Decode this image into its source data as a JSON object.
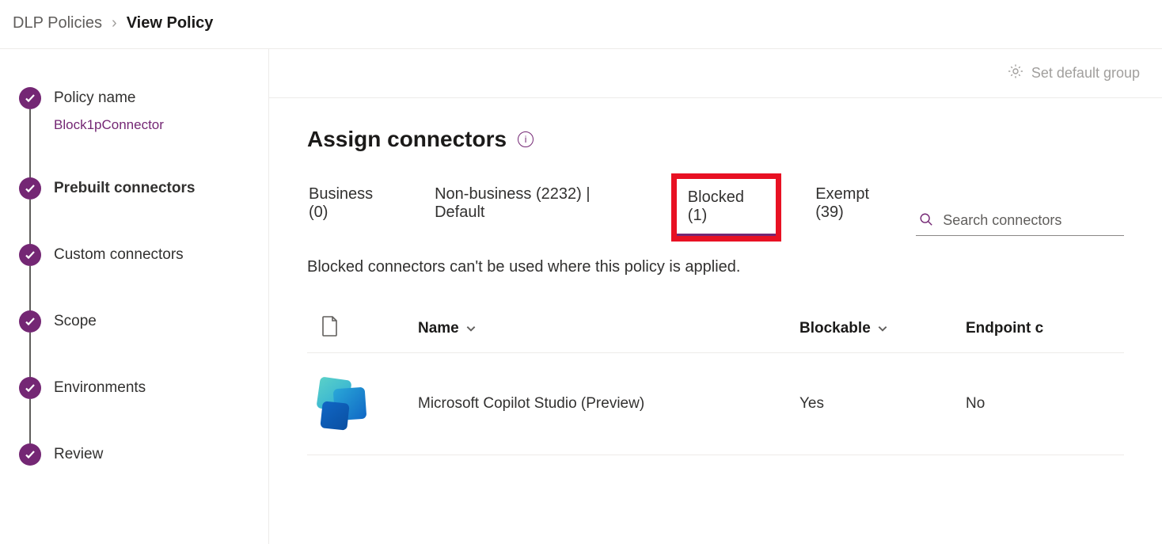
{
  "breadcrumb": {
    "root": "DLP Policies",
    "separator": "›",
    "current": "View Policy"
  },
  "steps": [
    {
      "label": "Policy name",
      "sublabel": "Block1pConnector",
      "active": false
    },
    {
      "label": "Prebuilt connectors",
      "active": true
    },
    {
      "label": "Custom connectors",
      "active": false
    },
    {
      "label": "Scope",
      "active": false
    },
    {
      "label": "Environments",
      "active": false
    },
    {
      "label": "Review",
      "active": false
    }
  ],
  "toolbar": {
    "setDefaultGroup": "Set default group"
  },
  "main": {
    "title": "Assign connectors",
    "infoGlyph": "i",
    "tabs": [
      {
        "label": "Business (0)"
      },
      {
        "label": "Non-business (2232) | Default"
      },
      {
        "label": "Blocked (1)",
        "selected": true,
        "highlight": true
      },
      {
        "label": "Exempt (39)"
      }
    ],
    "searchPlaceholder": "Search connectors",
    "tabDescription": "Blocked connectors can't be used where this policy is applied.",
    "columns": {
      "name": "Name",
      "blockable": "Blockable",
      "endpoint": "Endpoint c"
    },
    "rows": [
      {
        "name": "Microsoft Copilot Studio (Preview)",
        "blockable": "Yes",
        "endpoint": "No"
      }
    ]
  }
}
